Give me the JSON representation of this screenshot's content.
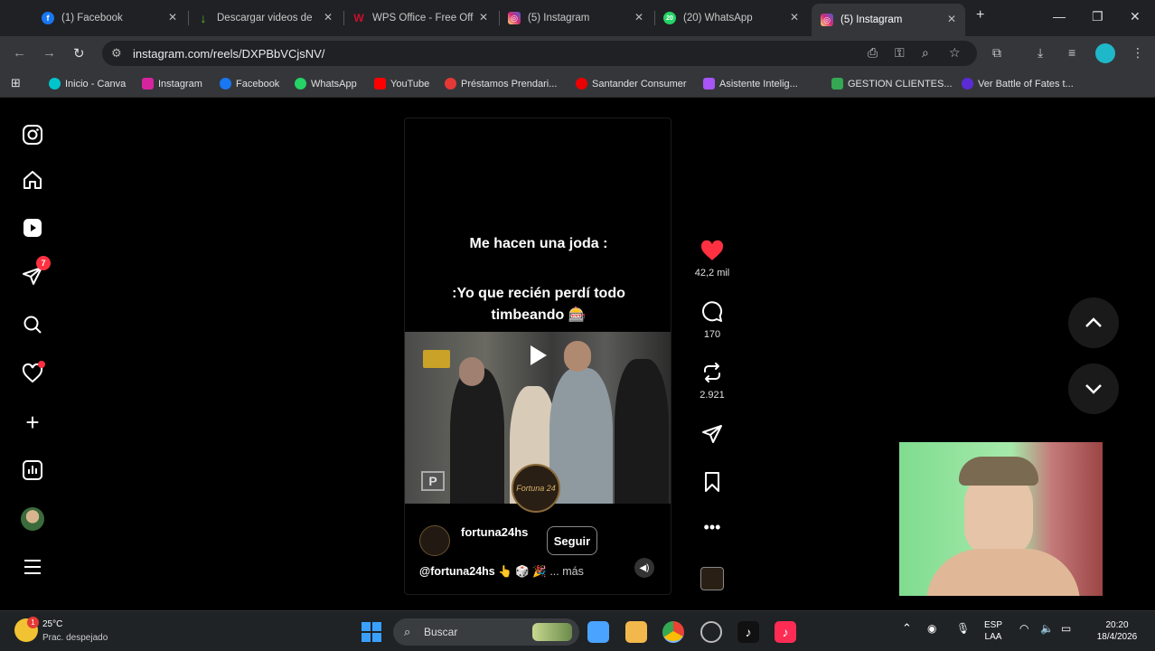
{
  "tabs": [
    {
      "title": "(1) Facebook",
      "color": "#1877f2",
      "glyph": "f"
    },
    {
      "title": "Descargar videos de",
      "color": "#5fb832",
      "glyph": "↓"
    },
    {
      "title": "WPS Office - Free Off",
      "color": "#c8102e",
      "glyph": "W"
    },
    {
      "title": "(5) Instagram",
      "color": "#d6249f",
      "glyph": "◎"
    },
    {
      "title": "(20) WhatsApp",
      "color": "#25d366",
      "glyph": "20"
    },
    {
      "title": "(5) Instagram",
      "color": "#d6249f",
      "glyph": "◎"
    }
  ],
  "address": {
    "url": "instagram.com/reels/DXPBbVCjsNV/"
  },
  "bookmarks": [
    {
      "label": "Inicio - Canva",
      "color": "#00c4cc"
    },
    {
      "label": "Instagram",
      "color": "#d6249f"
    },
    {
      "label": "Facebook",
      "color": "#1877f2"
    },
    {
      "label": "WhatsApp",
      "color": "#25d366"
    },
    {
      "label": "YouTube",
      "color": "#ff0000"
    },
    {
      "label": "Préstamos Prendari...",
      "color": "#e53935"
    },
    {
      "label": "Santander Consumer",
      "color": "#ec0000"
    },
    {
      "label": "Asistente Intelig...",
      "color": "#a855f7"
    },
    {
      "label": "GESTION CLIENTES...",
      "color": "#34a853"
    },
    {
      "label": "Ver Battle of Fates t...",
      "color": "#5b2bd6"
    }
  ],
  "sidebar": {
    "messages_badge": "7"
  },
  "reel": {
    "caption_line1": "Me hacen una joda :",
    "caption_line2": ":Yo que recién perdí todo",
    "caption_line3": "timbeando 🎰",
    "logo_text": "Fortuna 24",
    "username": "fortuna24hs",
    "follow_label": "Seguir",
    "description": "@fortuna24hs 👆 🎲 🎉",
    "more_label": "... más"
  },
  "actions": {
    "likes": "42,2 mil",
    "comments": "170",
    "reposts": "2.921"
  },
  "taskbar": {
    "weather_temp": "25°C",
    "weather_desc": "Prac. despejado",
    "weather_badge": "1",
    "search_label": "Buscar",
    "lang_top": "ESP",
    "lang_bottom": "LAA",
    "time": "20:20",
    "date": "18/4/2026"
  },
  "colors": {
    "like": "#ff3040",
    "accent": "#0095f6"
  }
}
